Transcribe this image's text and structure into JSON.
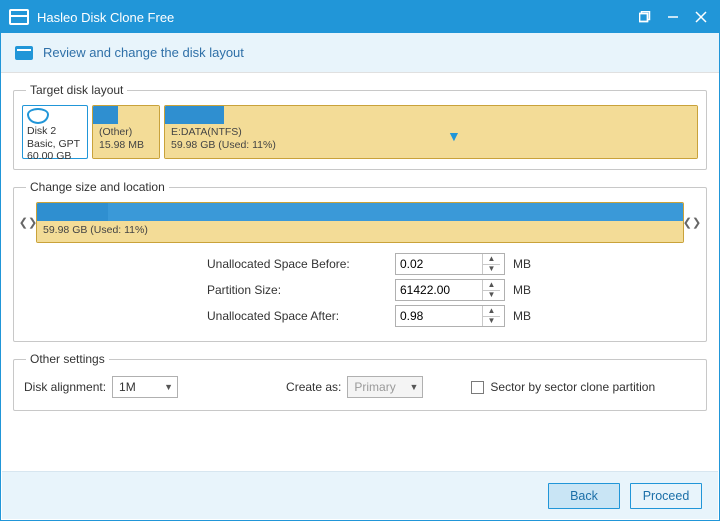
{
  "window": {
    "title": "Hasleo Disk Clone Free"
  },
  "subheader": {
    "text": "Review and change the disk layout"
  },
  "target_layout": {
    "legend": "Target disk layout",
    "disk": {
      "name": "Disk 2",
      "scheme": "Basic, GPT",
      "size": "60.00 GB"
    },
    "partitions": [
      {
        "label": "(Other)",
        "size": "15.98 MB",
        "used_pct": 38
      },
      {
        "label": "E:DATA(NTFS)",
        "size": "59.98 GB (Used: 11%)",
        "used_pct": 11
      }
    ]
  },
  "change": {
    "legend": "Change size and location",
    "caption": "59.98 GB (Used: 11%)",
    "fields": {
      "before_label": "Unallocated Space Before:",
      "before_value": "0.02",
      "size_label": "Partition Size:",
      "size_value": "61422.00",
      "after_label": "Unallocated Space After:",
      "after_value": "0.98",
      "unit": "MB"
    }
  },
  "other": {
    "legend": "Other settings",
    "alignment_label": "Disk alignment:",
    "alignment_value": "1M",
    "create_as_label": "Create as:",
    "create_as_value": "Primary",
    "sector_label": "Sector by sector clone partition"
  },
  "footer": {
    "back": "Back",
    "proceed": "Proceed"
  }
}
